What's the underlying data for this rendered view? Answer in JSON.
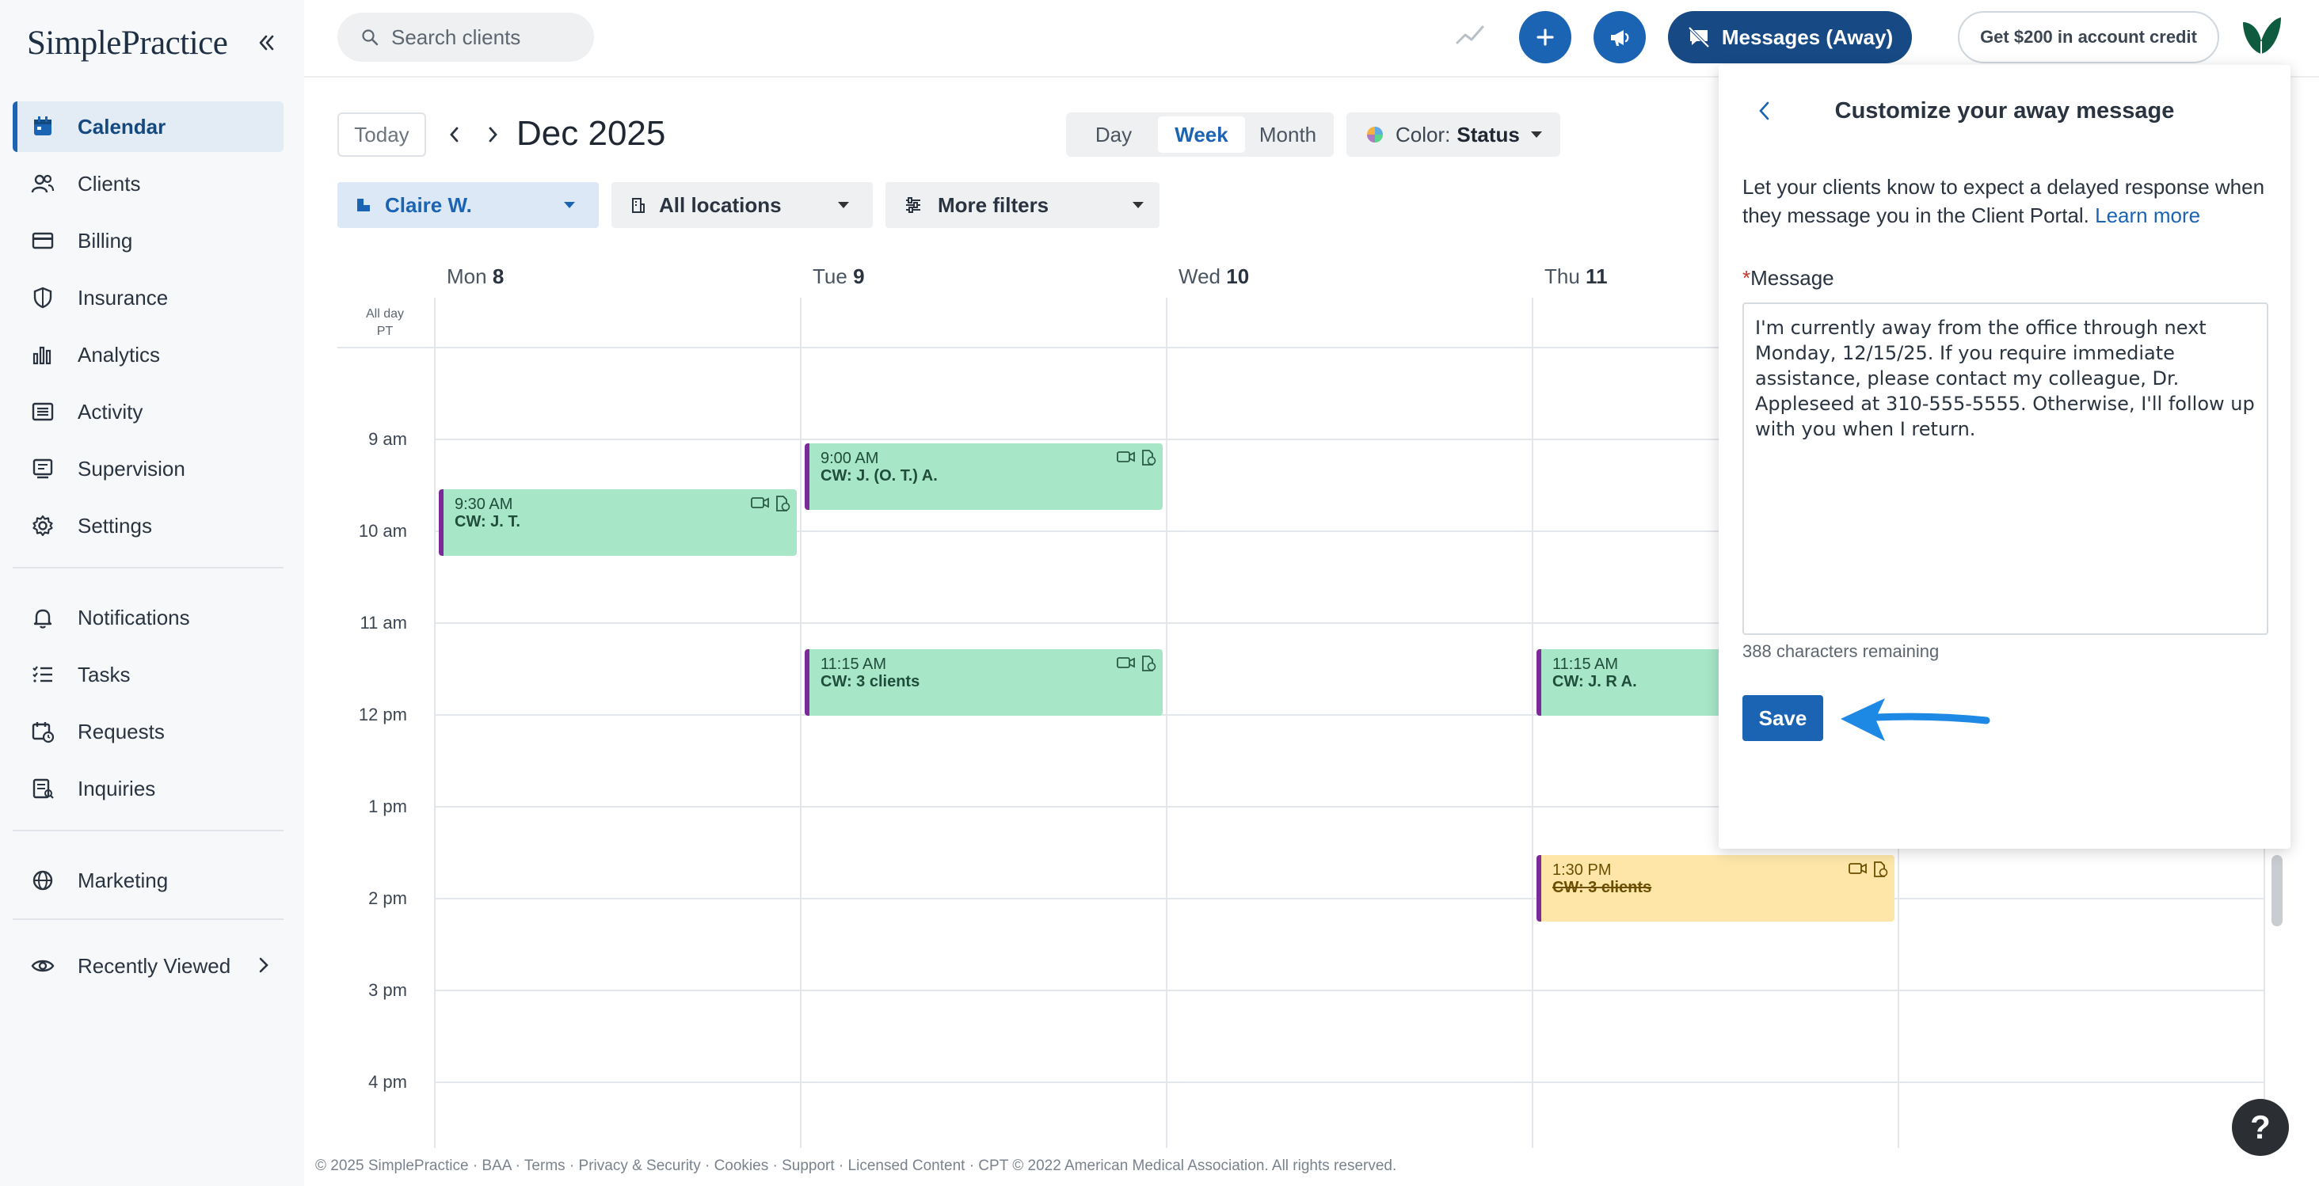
{
  "app": {
    "logo_text": "SimplePractice"
  },
  "sidebar": {
    "items": [
      {
        "label": "Calendar",
        "icon": "calendar-icon"
      },
      {
        "label": "Clients",
        "icon": "clients-icon"
      },
      {
        "label": "Billing",
        "icon": "billing-icon"
      },
      {
        "label": "Insurance",
        "icon": "shield-icon"
      },
      {
        "label": "Analytics",
        "icon": "analytics-icon"
      },
      {
        "label": "Activity",
        "icon": "activity-icon"
      },
      {
        "label": "Supervision",
        "icon": "supervision-icon"
      },
      {
        "label": "Settings",
        "icon": "gear-icon"
      },
      {
        "label": "Notifications",
        "icon": "bell-icon"
      },
      {
        "label": "Tasks",
        "icon": "tasks-icon"
      },
      {
        "label": "Requests",
        "icon": "requests-icon"
      },
      {
        "label": "Inquiries",
        "icon": "inquiries-icon"
      },
      {
        "label": "Marketing",
        "icon": "globe-icon"
      },
      {
        "label": "Recently Viewed",
        "icon": "eye-icon"
      }
    ]
  },
  "topbar": {
    "search_placeholder": "Search clients",
    "messages_label": "Messages (Away)",
    "credit_label": "Get $200 in account credit"
  },
  "calendar": {
    "today_label": "Today",
    "month_title": "Dec 2025",
    "views": [
      "Day",
      "Week",
      "Month"
    ],
    "selected_view": "Week",
    "color_label": "Color:",
    "color_value": "Status",
    "filters": {
      "clinician": "Claire W.",
      "locations": "All locations",
      "more": "More filters"
    },
    "days": [
      {
        "name": "Mon",
        "num": "8"
      },
      {
        "name": "Tue",
        "num": "9"
      },
      {
        "name": "Wed",
        "num": "10"
      },
      {
        "name": "Thu",
        "num": "11"
      }
    ],
    "allday_label": "All day",
    "tz_label": "PT",
    "hours": [
      "9 am",
      "10 am",
      "11 am",
      "12 pm",
      "1 pm",
      "2 pm",
      "3 pm",
      "4 pm"
    ],
    "events": [
      {
        "time": "9:30 AM",
        "name": "CW: J. T."
      },
      {
        "time": "9:00 AM",
        "name": "CW: J. (O. T.) A."
      },
      {
        "time": "11:15 AM",
        "name": "CW: 3 clients"
      },
      {
        "time": "11:15 AM",
        "name": "CW: J. R A."
      },
      {
        "time": "1:30 PM",
        "name": "CW: 3 clients"
      }
    ]
  },
  "panel": {
    "title": "Customize your away message",
    "description": "Let your clients know to expect a delayed response when they message you in the Client Portal.",
    "learn_more": "Learn more",
    "required_mark": "*",
    "field_label": "Message",
    "message": "I'm currently away from the office through next Monday, 12/15/25. If you require immediate assistance, please contact my colleague, Dr. Appleseed at 310-555-5555. Otherwise, I'll follow up with you when I return.",
    "chars_remaining": "388 characters remaining",
    "save_label": "Save"
  },
  "footer": {
    "text": "© 2025 SimplePractice · BAA · Terms · Privacy & Security · Cookies · Support · Licensed Content · CPT © 2022 American Medical Association. All rights reserved."
  },
  "help": {
    "label": "?"
  },
  "colors": {
    "primary": "#1b63b3",
    "messages_bg": "#174a85",
    "event_green": "#a8e6c8",
    "event_yellow": "#fde6a8",
    "event_border": "#7c2a9a",
    "annotation_arrow": "#1e88e5"
  }
}
